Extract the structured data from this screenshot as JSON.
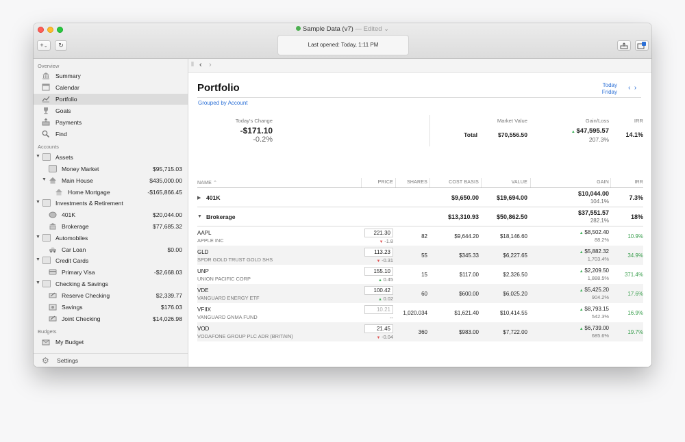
{
  "window": {
    "title": "Sample Data (v7)",
    "edited_label": "— Edited",
    "status": "Last opened: Today, 1:11 PM",
    "add_label": "+",
    "add_caret": "⌄",
    "refresh_label": "↻"
  },
  "sidebar": {
    "overview_label": "Overview",
    "overview": [
      {
        "label": "Summary"
      },
      {
        "label": "Calendar"
      },
      {
        "label": "Portfolio"
      },
      {
        "label": "Goals"
      },
      {
        "label": "Payments"
      },
      {
        "label": "Find"
      }
    ],
    "accounts_label": "Accounts",
    "accounts": [
      {
        "label": "Assets",
        "amount": ""
      },
      {
        "label": "Money Market",
        "amount": "$95,715.03"
      },
      {
        "label": "Main House",
        "amount": "$435,000.00"
      },
      {
        "label": "Home Mortgage",
        "amount": "-$165,866.45"
      },
      {
        "label": "Investments & Retirement",
        "amount": ""
      },
      {
        "label": "401K",
        "amount": "$20,044.00"
      },
      {
        "label": "Brokerage",
        "amount": "$77,685.32"
      },
      {
        "label": "Automobiles",
        "amount": ""
      },
      {
        "label": "Car Loan",
        "amount": "$0.00"
      },
      {
        "label": "Credit Cards",
        "amount": ""
      },
      {
        "label": "Primary Visa",
        "amount": "-$2,668.03"
      },
      {
        "label": "Checking & Savings",
        "amount": ""
      },
      {
        "label": "Reserve Checking",
        "amount": "$2,339.77"
      },
      {
        "label": "Savings",
        "amount": "$176.03"
      },
      {
        "label": "Joint Checking",
        "amount": "$14,026.98"
      }
    ],
    "budgets_label": "Budgets",
    "budgets": [
      {
        "label": "My Budget"
      }
    ],
    "settings_label": "Settings"
  },
  "content": {
    "title": "Portfolio",
    "date_today": "Today",
    "date_day": "Friday",
    "grouped_label": "Grouped by Account",
    "summary": {
      "todays_change_label": "Today's Change",
      "todays_change": "-$171.10",
      "todays_change_pct": "-0.2%",
      "market_value_label": "Market Value",
      "gain_loss_label": "Gain/Loss",
      "irr_label": "IRR",
      "total_label": "Total",
      "total_value": "$70,556.50",
      "total_gain": "$47,595.57",
      "total_gain_pct": "207.3%",
      "total_irr": "14.1%"
    },
    "columns": {
      "name": "NAME ⌃",
      "price": "PRICE",
      "shares": "SHARES",
      "cost_basis": "COST BASIS",
      "value": "VALUE",
      "gain": "GAIN",
      "irr": "IRR"
    },
    "groups": [
      {
        "name": "401K",
        "cost_basis": "$9,650.00",
        "value": "$19,694.00",
        "gain": "$10,044.00",
        "gain_pct": "104.1%",
        "irr": "7.3%"
      },
      {
        "name": "Brokerage",
        "cost_basis": "$13,310.93",
        "value": "$50,862.50",
        "gain": "$37,551.57",
        "gain_pct": "282.1%",
        "irr": "18%"
      }
    ],
    "holdings": [
      {
        "symbol": "AAPL",
        "name": "APPLE INC",
        "price": "221.30",
        "change": "-1.8",
        "dir": "down",
        "shares": "82",
        "cost_basis": "$9,644.20",
        "value": "$18,146.60",
        "gain": "$8,502.40",
        "gain_pct": "88.2%",
        "irr": "10.9%"
      },
      {
        "symbol": "GLD",
        "name": "SPDR GOLD TRUST GOLD SHS",
        "price": "113.23",
        "change": "-0.31",
        "dir": "down",
        "shares": "55",
        "cost_basis": "$345.33",
        "value": "$6,227.65",
        "gain": "$5,882.32",
        "gain_pct": "1,703.4%",
        "irr": "34.9%"
      },
      {
        "symbol": "UNP",
        "name": "UNION PACIFIC CORP",
        "price": "155.10",
        "change": "0.45",
        "dir": "up",
        "shares": "15",
        "cost_basis": "$117.00",
        "value": "$2,326.50",
        "gain": "$2,209.50",
        "gain_pct": "1,888.5%",
        "irr": "371.4%"
      },
      {
        "symbol": "VDE",
        "name": "VANGUARD ENERGY ETF",
        "price": "100.42",
        "change": "0.02",
        "dir": "up",
        "shares": "60",
        "cost_basis": "$600.00",
        "value": "$6,025.20",
        "gain": "$5,425.20",
        "gain_pct": "904.2%",
        "irr": "17.6%"
      },
      {
        "symbol": "VFIIX",
        "name": "VANGUARD GNMA FUND",
        "price": "10.21",
        "change": "--",
        "dir": "none",
        "shares": "1,020.034",
        "cost_basis": "$1,621.40",
        "value": "$10,414.55",
        "gain": "$8,793.15",
        "gain_pct": "542.3%",
        "irr": "16.9%"
      },
      {
        "symbol": "VOD",
        "name": "VODAFONE GROUP PLC ADR (BRITAIN)",
        "price": "21.45",
        "change": "-0.04",
        "dir": "down",
        "shares": "360",
        "cost_basis": "$983.00",
        "value": "$7,722.00",
        "gain": "$6,739.00",
        "gain_pct": "685.6%",
        "irr": "19.7%"
      }
    ]
  }
}
